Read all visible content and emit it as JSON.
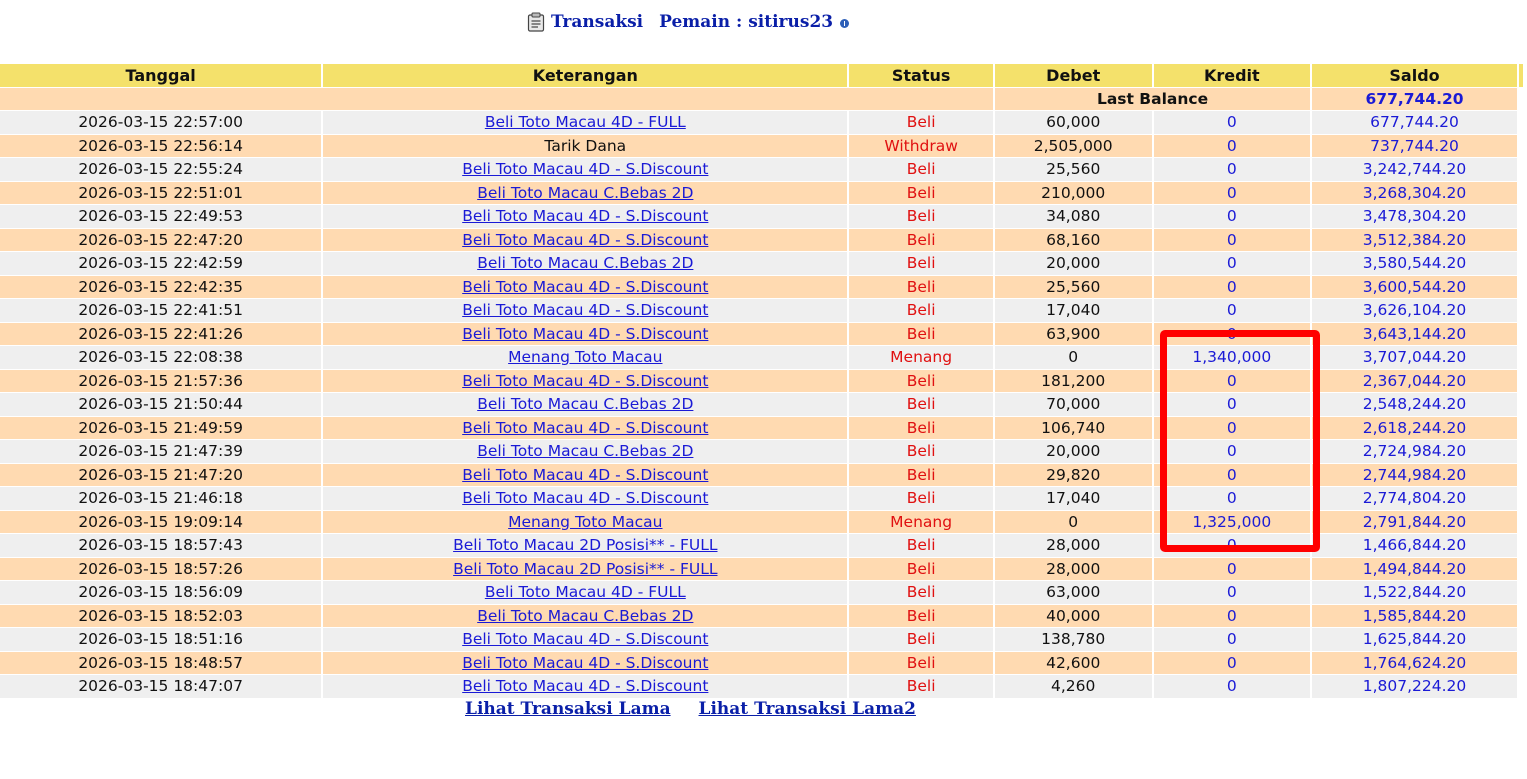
{
  "header": {
    "title_label": "Transaksi",
    "player_label": "Pemain : sitirus23",
    "clipboard_icon": "clipboard-icon",
    "info_icon": "info-icon"
  },
  "table": {
    "columns": [
      "Tanggal",
      "Keterangan",
      "Status",
      "Debet",
      "Kredit",
      "Saldo"
    ],
    "last_balance_label": "Last Balance",
    "last_balance_value": "677,744.20",
    "rows": [
      {
        "date": "2026-03-15 22:57:00",
        "desc": "Beli Toto Macau 4D - FULL",
        "link": true,
        "status": "Beli",
        "debet": "60,000",
        "kredit": "0",
        "saldo": "677,744.20"
      },
      {
        "date": "2026-03-15 22:56:14",
        "desc": "Tarik Dana",
        "link": false,
        "status": "Withdraw",
        "debet": "2,505,000",
        "kredit": "0",
        "saldo": "737,744.20"
      },
      {
        "date": "2026-03-15 22:55:24",
        "desc": "Beli Toto Macau 4D - S.Discount",
        "link": true,
        "status": "Beli",
        "debet": "25,560",
        "kredit": "0",
        "saldo": "3,242,744.20"
      },
      {
        "date": "2026-03-15 22:51:01",
        "desc": "Beli Toto Macau C.Bebas 2D",
        "link": true,
        "status": "Beli",
        "debet": "210,000",
        "kredit": "0",
        "saldo": "3,268,304.20"
      },
      {
        "date": "2026-03-15 22:49:53",
        "desc": "Beli Toto Macau 4D - S.Discount",
        "link": true,
        "status": "Beli",
        "debet": "34,080",
        "kredit": "0",
        "saldo": "3,478,304.20"
      },
      {
        "date": "2026-03-15 22:47:20",
        "desc": "Beli Toto Macau 4D - S.Discount",
        "link": true,
        "status": "Beli",
        "debet": "68,160",
        "kredit": "0",
        "saldo": "3,512,384.20"
      },
      {
        "date": "2026-03-15 22:42:59",
        "desc": "Beli Toto Macau C.Bebas 2D",
        "link": true,
        "status": "Beli",
        "debet": "20,000",
        "kredit": "0",
        "saldo": "3,580,544.20"
      },
      {
        "date": "2026-03-15 22:42:35",
        "desc": "Beli Toto Macau 4D - S.Discount",
        "link": true,
        "status": "Beli",
        "debet": "25,560",
        "kredit": "0",
        "saldo": "3,600,544.20"
      },
      {
        "date": "2026-03-15 22:41:51",
        "desc": "Beli Toto Macau 4D - S.Discount",
        "link": true,
        "status": "Beli",
        "debet": "17,040",
        "kredit": "0",
        "saldo": "3,626,104.20"
      },
      {
        "date": "2026-03-15 22:41:26",
        "desc": "Beli Toto Macau 4D - S.Discount",
        "link": true,
        "status": "Beli",
        "debet": "63,900",
        "kredit": "0",
        "saldo": "3,643,144.20"
      },
      {
        "date": "2026-03-15 22:08:38",
        "desc": "Menang Toto Macau",
        "link": true,
        "status": "Menang",
        "debet": "0",
        "kredit": "1,340,000",
        "saldo": "3,707,044.20"
      },
      {
        "date": "2026-03-15 21:57:36",
        "desc": "Beli Toto Macau 4D - S.Discount",
        "link": true,
        "status": "Beli",
        "debet": "181,200",
        "kredit": "0",
        "saldo": "2,367,044.20"
      },
      {
        "date": "2026-03-15 21:50:44",
        "desc": "Beli Toto Macau C.Bebas 2D",
        "link": true,
        "status": "Beli",
        "debet": "70,000",
        "kredit": "0",
        "saldo": "2,548,244.20"
      },
      {
        "date": "2026-03-15 21:49:59",
        "desc": "Beli Toto Macau 4D - S.Discount",
        "link": true,
        "status": "Beli",
        "debet": "106,740",
        "kredit": "0",
        "saldo": "2,618,244.20"
      },
      {
        "date": "2026-03-15 21:47:39",
        "desc": "Beli Toto Macau C.Bebas 2D",
        "link": true,
        "status": "Beli",
        "debet": "20,000",
        "kredit": "0",
        "saldo": "2,724,984.20"
      },
      {
        "date": "2026-03-15 21:47:20",
        "desc": "Beli Toto Macau 4D - S.Discount",
        "link": true,
        "status": "Beli",
        "debet": "29,820",
        "kredit": "0",
        "saldo": "2,744,984.20"
      },
      {
        "date": "2026-03-15 21:46:18",
        "desc": "Beli Toto Macau 4D - S.Discount",
        "link": true,
        "status": "Beli",
        "debet": "17,040",
        "kredit": "0",
        "saldo": "2,774,804.20"
      },
      {
        "date": "2026-03-15 19:09:14",
        "desc": "Menang Toto Macau",
        "link": true,
        "status": "Menang",
        "debet": "0",
        "kredit": "1,325,000",
        "saldo": "2,791,844.20"
      },
      {
        "date": "2026-03-15 18:57:43",
        "desc": "Beli Toto Macau 2D Posisi** - FULL",
        "link": true,
        "status": "Beli",
        "debet": "28,000",
        "kredit": "0",
        "saldo": "1,466,844.20"
      },
      {
        "date": "2026-03-15 18:57:26",
        "desc": "Beli Toto Macau 2D Posisi** - FULL",
        "link": true,
        "status": "Beli",
        "debet": "28,000",
        "kredit": "0",
        "saldo": "1,494,844.20"
      },
      {
        "date": "2026-03-15 18:56:09",
        "desc": "Beli Toto Macau 4D - FULL",
        "link": true,
        "status": "Beli",
        "debet": "63,000",
        "kredit": "0",
        "saldo": "1,522,844.20"
      },
      {
        "date": "2026-03-15 18:52:03",
        "desc": "Beli Toto Macau C.Bebas 2D",
        "link": true,
        "status": "Beli",
        "debet": "40,000",
        "kredit": "0",
        "saldo": "1,585,844.20"
      },
      {
        "date": "2026-03-15 18:51:16",
        "desc": "Beli Toto Macau 4D - S.Discount",
        "link": true,
        "status": "Beli",
        "debet": "138,780",
        "kredit": "0",
        "saldo": "1,625,844.20"
      },
      {
        "date": "2026-03-15 18:48:57",
        "desc": "Beli Toto Macau 4D - S.Discount",
        "link": true,
        "status": "Beli",
        "debet": "42,600",
        "kredit": "0",
        "saldo": "1,764,624.20"
      },
      {
        "date": "2026-03-15 18:47:07",
        "desc": "Beli Toto Macau 4D - S.Discount",
        "link": true,
        "status": "Beli",
        "debet": "4,260",
        "kredit": "0",
        "saldo": "1,807,224.20"
      }
    ]
  },
  "footer": {
    "link_old": "Lihat Transaksi Lama",
    "link_old2": "Lihat Transaksi Lama2"
  },
  "colors": {
    "header_bg": "#f4e16b",
    "row_even": "#efefef",
    "row_odd": "#ffdab1",
    "link": "#1a1ad6",
    "status": "#e01010",
    "highlight_box": "#ff0000"
  }
}
